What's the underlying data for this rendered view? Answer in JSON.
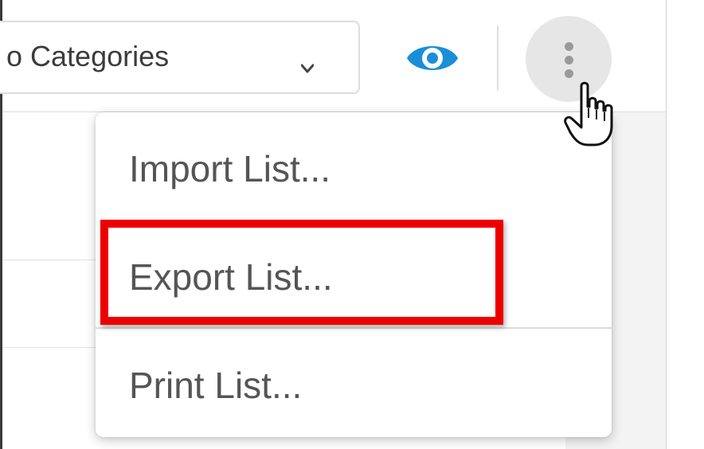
{
  "toolbar": {
    "category_dropdown": {
      "value": "o Categories"
    },
    "eye_icon": "eye-icon",
    "more_icon": "more-vertical-icon",
    "colors": {
      "eye": "#1a8fd8",
      "more_button_bg": "#e6e6e6"
    }
  },
  "menu": {
    "items": [
      {
        "label": "Import List..."
      },
      {
        "label": "Export List..."
      },
      {
        "label": "Print List..."
      }
    ],
    "highlight_color": "#ee0000"
  }
}
